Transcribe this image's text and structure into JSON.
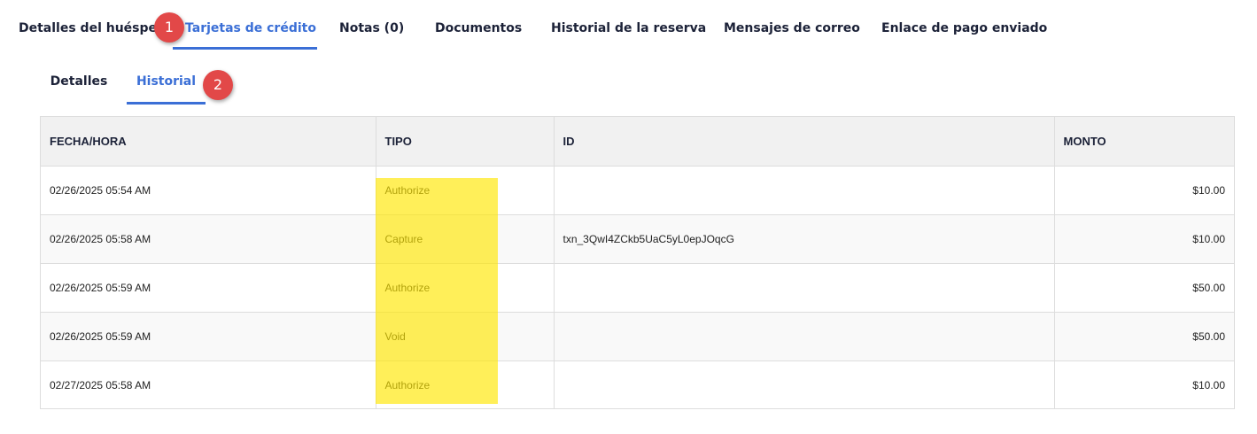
{
  "tabs": [
    {
      "label": "Detalles del huésped",
      "active": false
    },
    {
      "label": "Tarjetas de crédito",
      "active": true
    },
    {
      "label": "Notas (0)",
      "active": false
    },
    {
      "label": "Documentos",
      "active": false
    },
    {
      "label": "Historial de la reserva",
      "active": false
    },
    {
      "label": "Mensajes de correo",
      "active": false
    },
    {
      "label": "Enlace de pago enviado",
      "active": false
    }
  ],
  "subtabs": [
    {
      "label": "Detalles",
      "active": false
    },
    {
      "label": "Historial",
      "active": true
    }
  ],
  "callouts": [
    "1",
    "2"
  ],
  "table": {
    "headers": {
      "date": "FECHA/HORA",
      "type": "TIPO",
      "id": "ID",
      "amount": "MONTO"
    },
    "rows": [
      {
        "date": "02/26/2025 05:54 AM",
        "type": "Authorize",
        "id": "",
        "amount": "$10.00"
      },
      {
        "date": "02/26/2025 05:58 AM",
        "type": "Capture",
        "id": "txn_3QwI4ZCkb5UaC5yL0epJOqcG",
        "amount": "$10.00"
      },
      {
        "date": "02/26/2025 05:59 AM",
        "type": "Authorize",
        "id": "",
        "amount": "$50.00"
      },
      {
        "date": "02/26/2025 05:59 AM",
        "type": "Void",
        "id": "",
        "amount": "$50.00"
      },
      {
        "date": "02/27/2025 05:58 AM",
        "type": "Authorize",
        "id": "",
        "amount": "$10.00"
      }
    ]
  },
  "colors": {
    "accent": "#3b6fd6",
    "callout": "#e24848",
    "highlight": "#ffe600"
  }
}
